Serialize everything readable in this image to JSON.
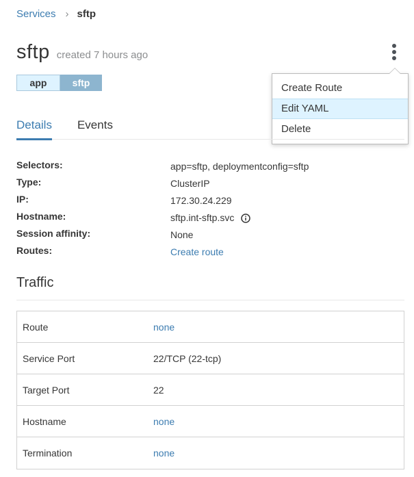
{
  "breadcrumb": {
    "parent": "Services",
    "separator": "›",
    "current": "sftp"
  },
  "header": {
    "title": "sftp",
    "created": "created 7 hours ago",
    "menu_icon": "kebab-vertical-icon"
  },
  "actions_menu": {
    "items": [
      {
        "label": "Create Route",
        "active": false
      },
      {
        "label": "Edit YAML",
        "active": true
      },
      {
        "label": "Delete",
        "active": false
      }
    ]
  },
  "labels": [
    {
      "key": "app",
      "value": "sftp"
    }
  ],
  "tabs": [
    {
      "label": "Details",
      "active": true
    },
    {
      "label": "Events",
      "active": false
    }
  ],
  "details": {
    "selectors": {
      "label": "Selectors:",
      "value": "app=sftp, deploymentconfig=sftp"
    },
    "type": {
      "label": "Type:",
      "value": "ClusterIP"
    },
    "ip": {
      "label": "IP:",
      "value": "172.30.24.229"
    },
    "hostname": {
      "label": "Hostname:",
      "value": "sftp.int-sftp.svc",
      "icon": "info-icon"
    },
    "session_affinity": {
      "label": "Session affinity:",
      "value": "None"
    },
    "routes": {
      "label": "Routes:",
      "value": "Create route"
    }
  },
  "traffic": {
    "heading": "Traffic",
    "rows": [
      {
        "key": "Route",
        "value": "none"
      },
      {
        "key": "Service Port",
        "value": "22/TCP (22-tcp)"
      },
      {
        "key": "Target Port",
        "value": "22"
      },
      {
        "key": "Hostname",
        "value": "none"
      },
      {
        "key": "Termination",
        "value": "none"
      }
    ]
  },
  "colors": {
    "link": "#3c7cb0",
    "menu_active_bg": "#def3ff",
    "label_value_bg": "#8db5cf"
  }
}
